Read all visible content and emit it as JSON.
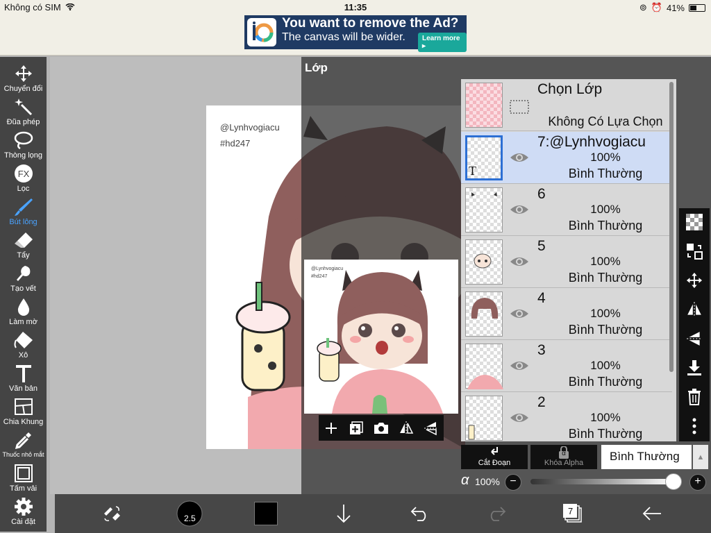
{
  "status": {
    "carrier": "Không có SIM",
    "time": "11:35",
    "battery": "41%"
  },
  "ad": {
    "title": "You want to remove the Ad?",
    "subtitle": "The canvas will be wider.",
    "button": "Learn more ▸"
  },
  "toolbar": {
    "tools": [
      {
        "label": "Chuyển đổi",
        "icon": "move-icon"
      },
      {
        "label": "Đũa phép",
        "icon": "magic-wand-icon"
      },
      {
        "label": "Thòng lọng",
        "icon": "lasso-icon"
      },
      {
        "label": "Lọc",
        "icon": "fx-icon"
      },
      {
        "label": "Bút lông",
        "icon": "brush-icon"
      },
      {
        "label": "Tẩy",
        "icon": "eraser-icon"
      },
      {
        "label": "Tạo vết",
        "icon": "smudge-icon"
      },
      {
        "label": "Làm mờ",
        "icon": "blur-icon"
      },
      {
        "label": "Xô",
        "icon": "bucket-icon"
      },
      {
        "label": "Văn bản",
        "icon": "text-icon"
      },
      {
        "label": "Chia Khung",
        "icon": "frame-divider-icon"
      },
      {
        "label": "Thuốc nhỏ mắt",
        "icon": "eyedropper-icon"
      },
      {
        "label": "Tấm vải",
        "icon": "canvas-icon"
      },
      {
        "label": "Cài đặt",
        "icon": "settings-icon"
      }
    ]
  },
  "artwork": {
    "handle": "@Lynhvogiacu",
    "tag": "#hd247"
  },
  "panel": {
    "title": "Lớp"
  },
  "layers": {
    "selection": {
      "title": "Chọn Lớp",
      "value": "Không Có Lựa Chọn"
    },
    "items": [
      {
        "name": "7:@Lynhvogiacu",
        "opacity": "100%",
        "mode": "Bình Thường",
        "thumb_glyph": "T"
      },
      {
        "name": "6",
        "opacity": "100%",
        "mode": "Bình Thường"
      },
      {
        "name": "5",
        "opacity": "100%",
        "mode": "Bình Thường"
      },
      {
        "name": "4",
        "opacity": "100%",
        "mode": "Bình Thường"
      },
      {
        "name": "3",
        "opacity": "100%",
        "mode": "Bình Thường"
      },
      {
        "name": "2",
        "opacity": "100%",
        "mode": "Bình Thường"
      }
    ]
  },
  "controls": {
    "clip_label": "Cắt Đoạn",
    "alpha_lock_label": "Khóa Alpha",
    "alpha_lock_glyph": "α",
    "blend_mode": "Bình Thường",
    "alpha_symbol": "α",
    "opacity": "100%",
    "opacity_value": 1.0
  },
  "bottom": {
    "brush_size": "2.5",
    "layer_count": "7",
    "color": "#000000"
  },
  "colors": {
    "accent": "#2c6fd4",
    "selected_row": "#cfdcf5",
    "active_tool": "#4aa3ff"
  }
}
